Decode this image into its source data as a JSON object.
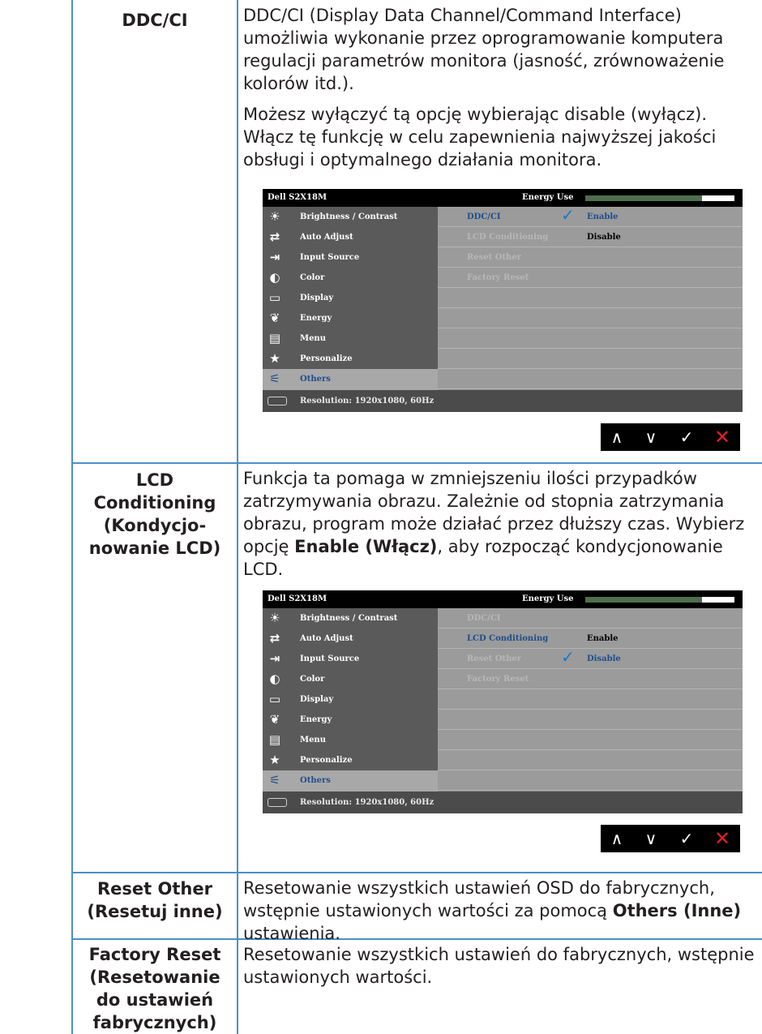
{
  "rows": [
    {
      "label": "DDC/CI",
      "paragraphs": [
        "DDC/CI (Display Data Channel/Command Interface) umożliwia wykonanie przez oprogramowanie komputera regulacji parametrów monitora (jasność, zrównoważenie kolorów itd.).",
        "Możesz wyłączyć tą opcję wybierając disable (wyłącz). Włącz tę funkcję w celu zapewnienia najwyższej jakości obsługi i optymalnego działania monitora."
      ]
    },
    {
      "label_lines": [
        "LCD",
        "Conditioning",
        "(Kondycjo-",
        "nowanie LCD)"
      ],
      "text_before": "Funkcja ta pomaga w zmniejszeniu ilości przypadków zatrzymywania obrazu. Zależnie od stopnia zatrzymania obrazu, program może działać przez dłuższy czas. Wybierz opcję ",
      "text_bold": "Enable (Włącz)",
      "text_after": ", aby rozpocząć kondycjonowanie LCD."
    },
    {
      "label_lines": [
        "Reset Other",
        "(Resetuj inne)"
      ],
      "text_before": "Resetowanie wszystkich ustawień OSD do fabrycznych, wstępnie ustawionych wartości za pomocą ",
      "text_bold": "Others (Inne)",
      "text_after": " ustawienia."
    },
    {
      "label_lines": [
        "Factory Reset",
        "(Resetowanie",
        "do ustawień",
        "fabrycznych)"
      ],
      "text": "Resetowanie wszystkich ustawień do fabrycznych, wstępnie ustawionych wartości."
    }
  ],
  "osd": {
    "title": "Dell S2X18M",
    "energy_label": "Energy Use",
    "energy_level": 0.78,
    "menu": [
      {
        "icon": "brightness-icon",
        "glyph": "☀",
        "label": "Brightness / Contrast"
      },
      {
        "icon": "auto-adjust-icon",
        "glyph": "⇄",
        "label": "Auto Adjust"
      },
      {
        "icon": "input-source-icon",
        "glyph": "⇥",
        "label": "Input Source"
      },
      {
        "icon": "color-icon",
        "glyph": "◐",
        "label": "Color"
      },
      {
        "icon": "display-icon",
        "glyph": "▭",
        "label": "Display"
      },
      {
        "icon": "energy-icon",
        "glyph": "❦",
        "label": "Energy"
      },
      {
        "icon": "menu-icon",
        "glyph": "▤",
        "label": "Menu"
      },
      {
        "icon": "personalize-icon",
        "glyph": "★",
        "label": "Personalize"
      },
      {
        "icon": "others-icon",
        "glyph": "⚟",
        "label": "Others"
      }
    ],
    "resolution": "Resolution: 1920x1080, 60Hz",
    "sub_items": [
      "DDC/CI",
      "LCD Conditioning",
      "Reset Other",
      "Factory Reset"
    ],
    "screen1": {
      "enable": "Enable",
      "disable": "Disable"
    },
    "screen2": {
      "enable": "Enable",
      "disable": "Disable"
    },
    "nav": {
      "up": "∧",
      "down": "∨",
      "ok": "✓",
      "close": "✕"
    }
  }
}
